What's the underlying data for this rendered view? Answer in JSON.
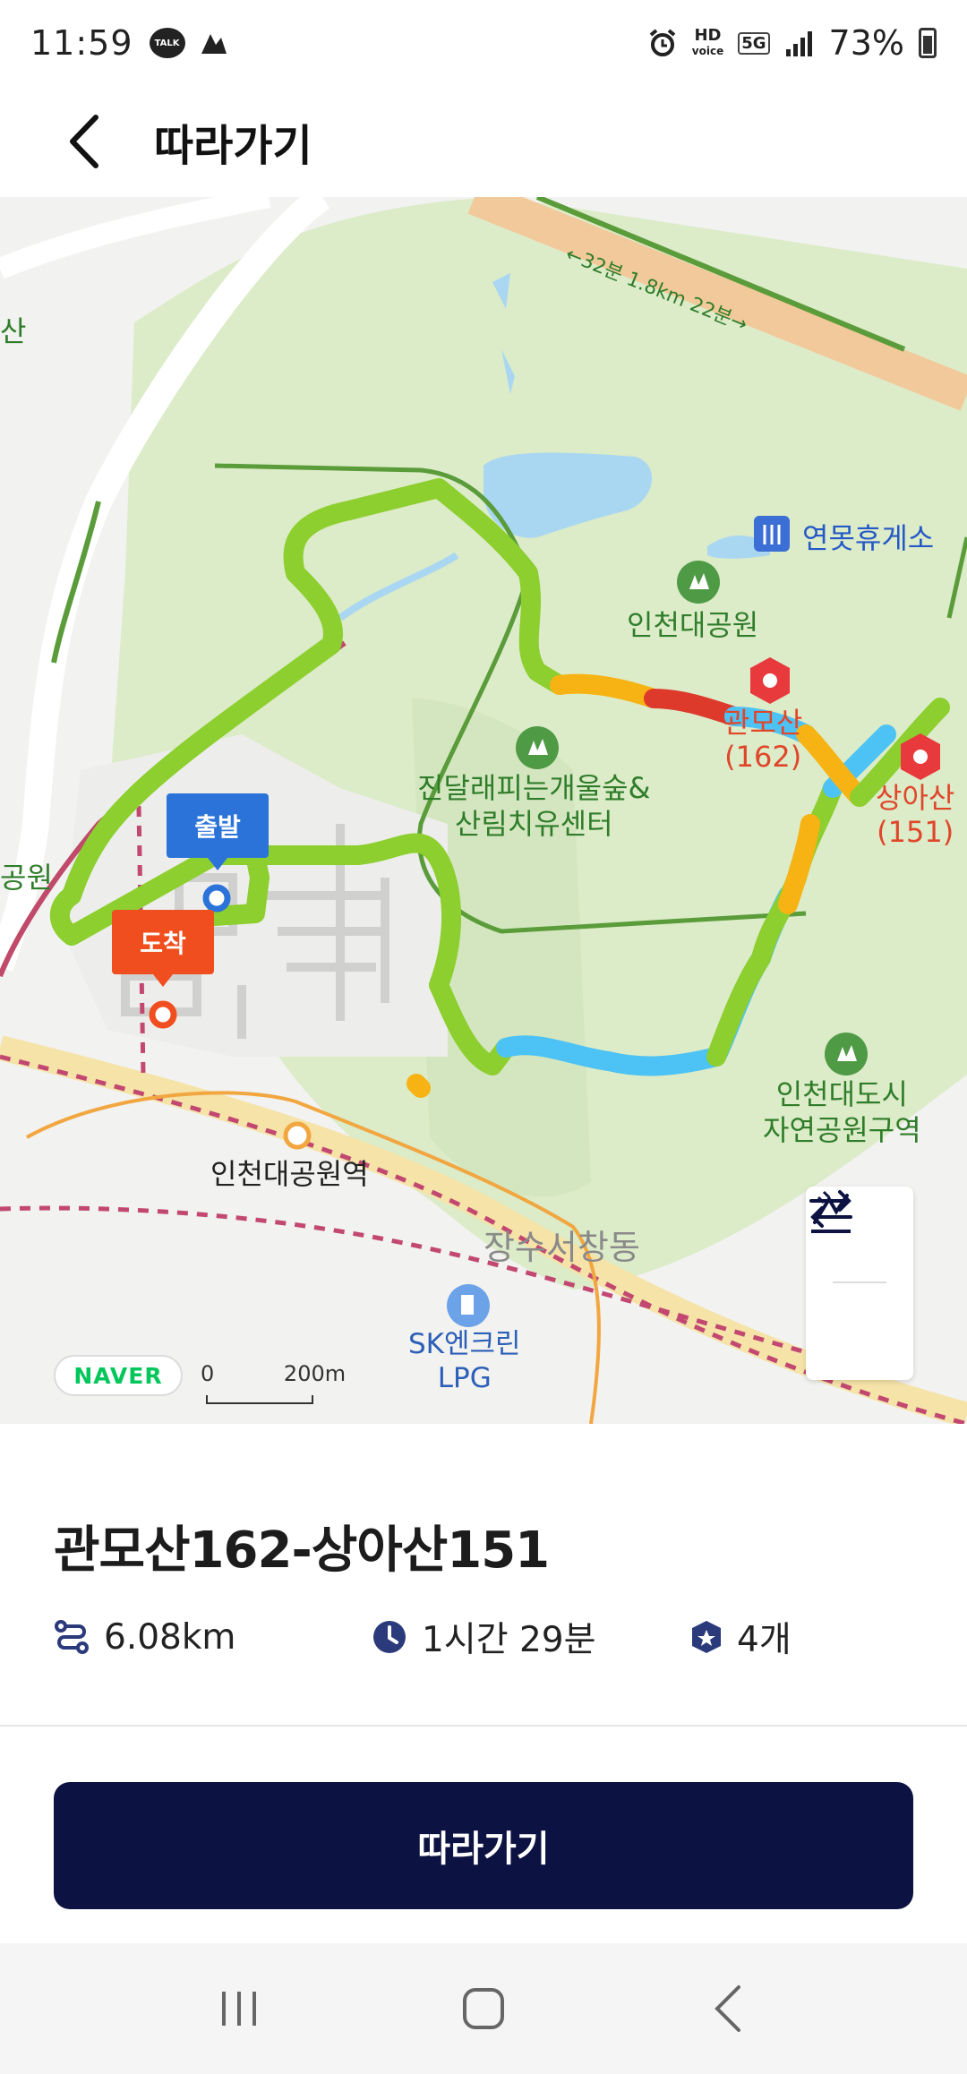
{
  "status_bar": {
    "time": "11:59",
    "talk_label": "TALK",
    "hd_label": "HD",
    "voice_label": "voice",
    "network_label": "5G",
    "battery": "73%"
  },
  "header": {
    "title": "따라가기"
  },
  "map": {
    "labels": {
      "park": "인천대공원",
      "rest_area": "연못휴게소",
      "forest_center_line1": "진달래피는개울숲&",
      "forest_center_line2": "산림치유센터",
      "peak1_name": "관모산",
      "peak1_height": "(162)",
      "peak2_name": "상아산",
      "peak2_height": "(151)",
      "urban_park_line1": "인천대도시",
      "urban_park_line2": "자연공원구역",
      "station": "인천대공원역",
      "district": "장수서창동",
      "gas_line1": "SK엔크린",
      "gas_line2": "LPG",
      "left_edge_top": "산",
      "left_edge_mid": "공원",
      "road_time": "←32분 1.8km 22분→"
    },
    "start_tag": "출발",
    "end_tag": "도착",
    "naver_label": "NAVER",
    "scale_zero": "0",
    "scale_distance": "200m",
    "colors": {
      "route_green": "#8ccf2e",
      "route_orange": "#f7b313",
      "route_red": "#de3a2c",
      "route_blue": "#4dc3f5",
      "park_green": "#dcebc8",
      "water": "#a9d7f2",
      "brand_navy": "#0c1241"
    }
  },
  "course": {
    "title": "관모산162-상아산151",
    "distance": "6.08km",
    "duration": "1시간 29분",
    "peaks": "4개"
  },
  "follow_button": "따라가기",
  "nav": {
    "recent": "recent-apps-icon",
    "home": "home-icon",
    "back": "back-icon"
  }
}
